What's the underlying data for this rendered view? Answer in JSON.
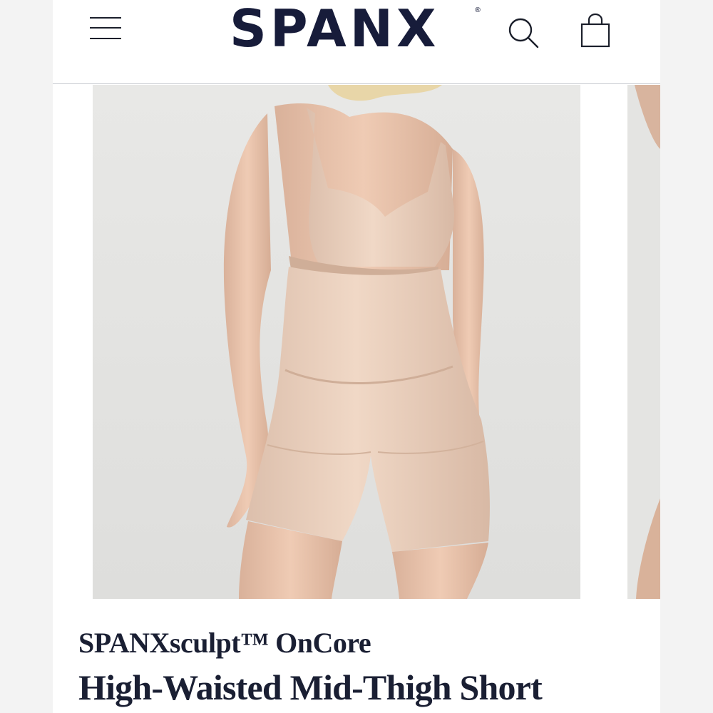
{
  "header": {
    "logo_text": "SPANX",
    "logo_mark": "®",
    "menu_icon": "hamburger-menu-icon",
    "search_icon": "search-icon",
    "bag_icon": "shopping-bag-icon"
  },
  "product": {
    "collection": "SPANXsculpt™ OnCore",
    "name": "High-Waisted Mid-Thigh Short"
  },
  "colors": {
    "brand_navy": "#171c3a",
    "photo_background": "#e4e4e2",
    "garment_nude": "#e8cdb8"
  }
}
